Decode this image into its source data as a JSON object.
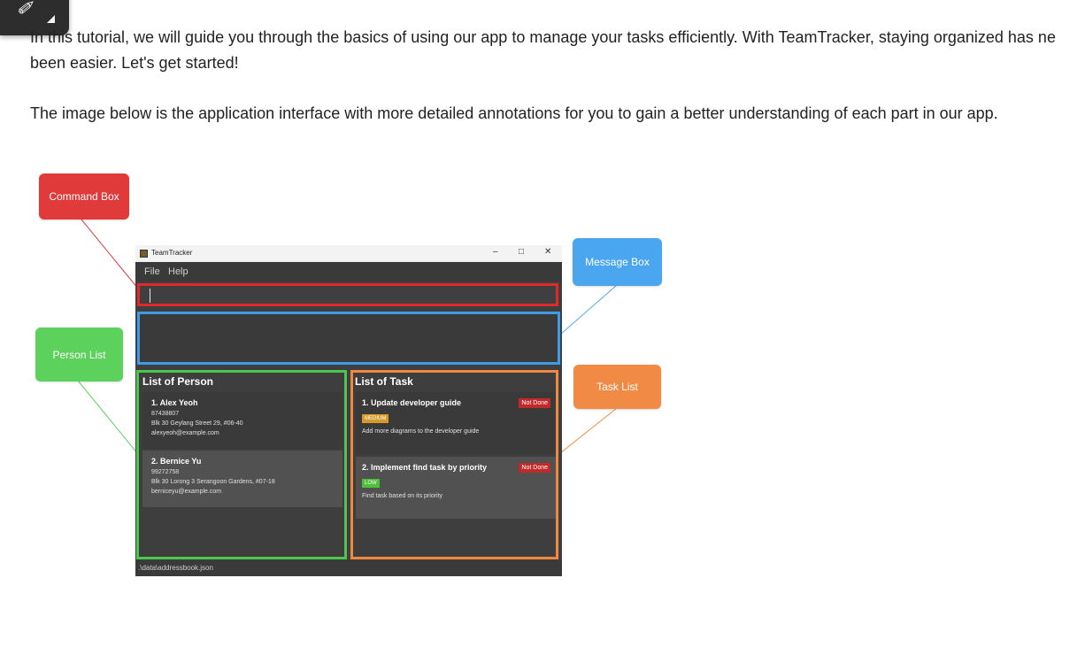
{
  "tutorial": {
    "intro_line1": "In this tutorial, we will guide you through the basics of using our app to manage your tasks efficiently. With TeamTracker, staying organized has ne",
    "intro_line2": "been easier. Let's get started!",
    "image_intro": "The image below is the application interface with more detailed annotations for you to gain a better understanding of each part in our app."
  },
  "toolbar": {
    "pen_icon": "pen-icon"
  },
  "callouts": {
    "command_box": "Command Box",
    "message_box": "Message Box",
    "person_list": "Person List",
    "task_list": "Task List"
  },
  "colors": {
    "command": "#e03a3a",
    "message": "#4aa6ef",
    "person": "#5cd15c",
    "task": "#f08a45"
  },
  "app": {
    "window_title": "TeamTracker",
    "menu": [
      "File",
      "Help"
    ],
    "person_panel_title": "List of Person",
    "task_panel_title": "List of Task",
    "persons": [
      {
        "name": "1.  Alex Yeoh",
        "phone": "87438807",
        "address": "Blk 30 Geylang Street 29, #06-40",
        "email": "alexyeoh@example.com"
      },
      {
        "name": "2.  Bernice Yu",
        "phone": "99272758",
        "address": "Blk 30 Lorong 3 Serangoon Gardens, #07-18",
        "email": "berniceyu@example.com"
      }
    ],
    "tasks": [
      {
        "name": "1. Update developer guide",
        "status": "Not Done",
        "priority": "MEDIUM",
        "description": "Add more diagrams to the developer guide"
      },
      {
        "name": "2. Implement find task by priority",
        "status": "Not Done",
        "priority": "LOW",
        "description": "Find task based on its priority"
      }
    ],
    "status_path": ".\\data\\addressbook.json"
  }
}
